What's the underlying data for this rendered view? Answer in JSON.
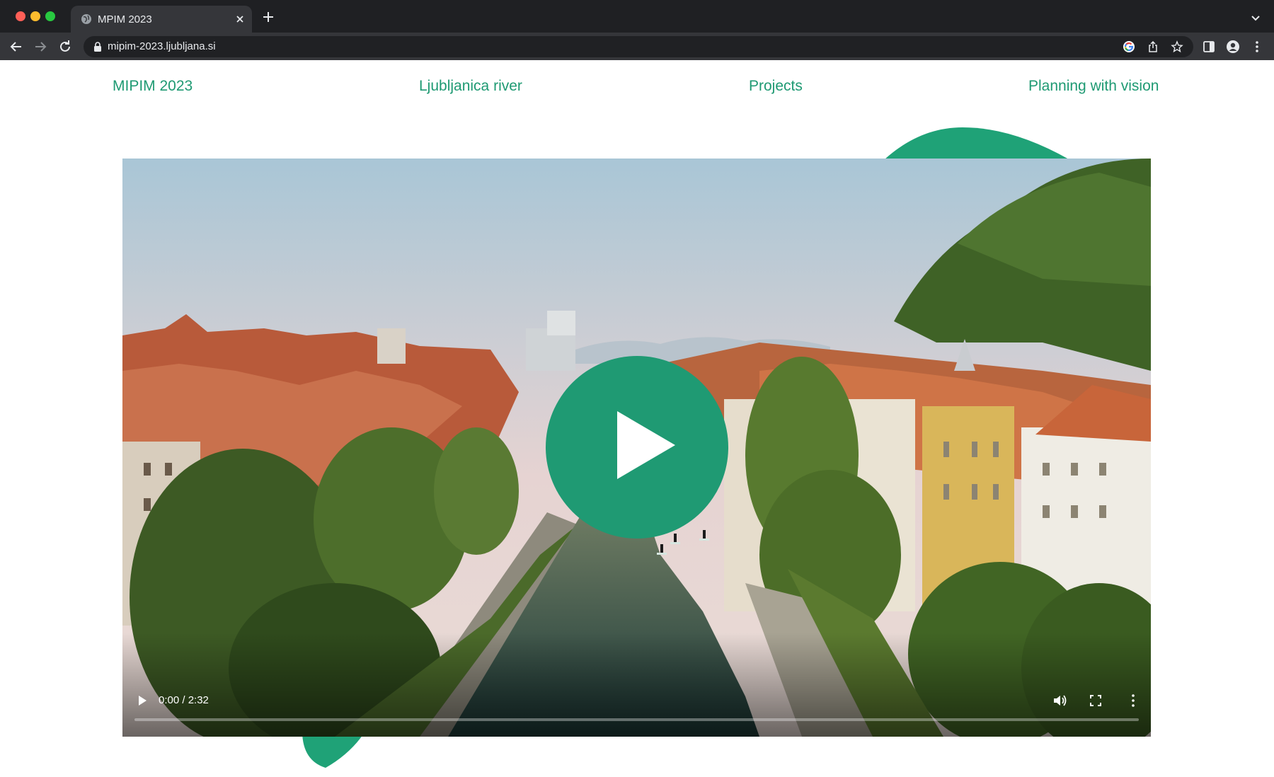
{
  "browser": {
    "tab_title": "MPIM 2023",
    "url": "mipim-2023.ljubljana.si"
  },
  "nav": {
    "items": [
      {
        "label": "MIPIM 2023"
      },
      {
        "label": "Ljubljanica river"
      },
      {
        "label": "Projects"
      },
      {
        "label": "Planning with vision"
      }
    ]
  },
  "video": {
    "time": "0:00 / 2:32",
    "progress_fraction": 0
  },
  "colors": {
    "accent": "#1f9a73",
    "chrome_dark": "#202124",
    "chrome_mid": "#35363a"
  }
}
